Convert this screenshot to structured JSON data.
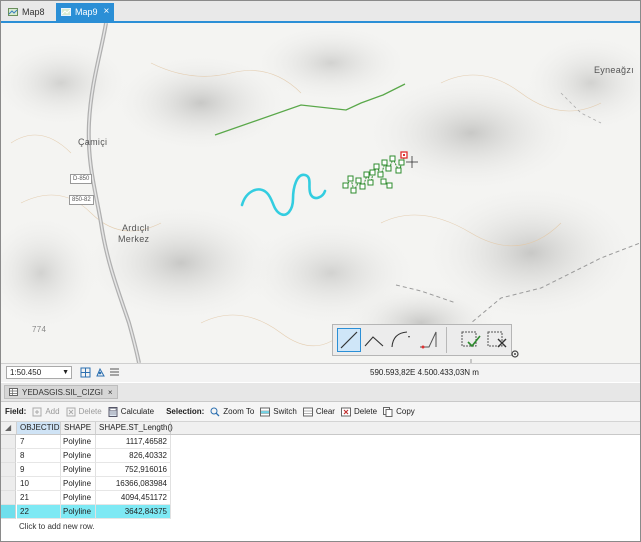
{
  "tabs": [
    {
      "label": "Map8",
      "active": false
    },
    {
      "label": "Map9",
      "active": true
    }
  ],
  "map": {
    "places": [
      "Eyneağzı",
      "Çamiçi",
      "Ardıçlı",
      "Merkez"
    ],
    "road_labels": [
      "D-850",
      "850-82"
    ],
    "elevation_label": "774"
  },
  "map_status": {
    "scale": "1:50.450",
    "coordinates": "590.593,82E 4.500.433,03N m"
  },
  "table_tab": {
    "label": "YEDASGIS.SIL_CIZGI",
    "close": "×"
  },
  "table_toolbar": {
    "field_label": "Field:",
    "add": "Add",
    "delete": "Delete",
    "calculate": "Calculate",
    "selection_label": "Selection:",
    "zoom_to": "Zoom To",
    "switch": "Switch",
    "clear": "Clear",
    "delete_sel": "Delete",
    "copy": "Copy"
  },
  "table": {
    "columns": [
      "OBJECTID",
      "SHAPE",
      "SHAPE.ST_Length()"
    ],
    "rows": [
      {
        "objectid": "7",
        "shape": "Polyline",
        "length": "1117,46582"
      },
      {
        "objectid": "8",
        "shape": "Polyline",
        "length": "826,40332"
      },
      {
        "objectid": "9",
        "shape": "Polyline",
        "length": "752,916016"
      },
      {
        "objectid": "10",
        "shape": "Polyline",
        "length": "16366,083984"
      },
      {
        "objectid": "21",
        "shape": "Polyline",
        "length": "4094,451172"
      },
      {
        "objectid": "22",
        "shape": "Polyline",
        "length": "3642,84375"
      }
    ],
    "selected_row": "22",
    "add_row_text": "Click to add new row."
  },
  "colors": {
    "accent": "#2b8fd6",
    "highlight_row": "#7ee9f4",
    "selected_line": "#33cde0",
    "green_line": "#5aa84a",
    "vertex_green": "#2e8b2e",
    "vertex_red": "#e03030"
  }
}
